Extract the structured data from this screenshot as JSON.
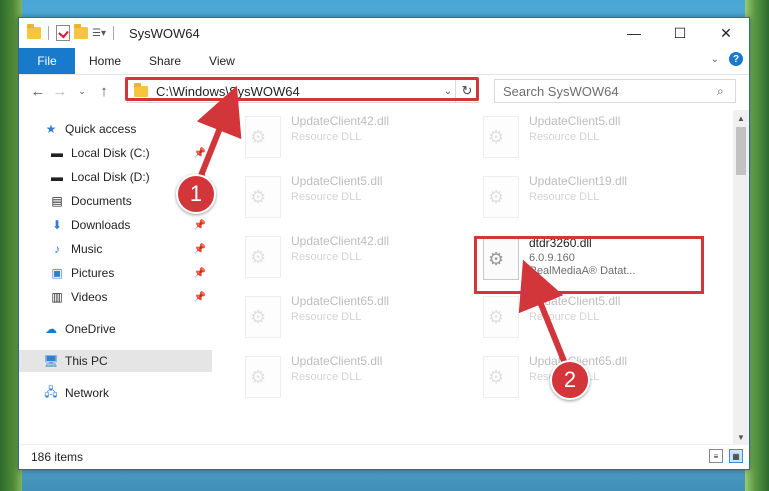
{
  "window": {
    "title": "SysWOW64"
  },
  "window_controls": {
    "minimize": "—",
    "maximize": "☐",
    "close": "✕"
  },
  "ribbon": {
    "tabs": [
      "File",
      "Home",
      "Share",
      "View"
    ],
    "help": "?"
  },
  "address": {
    "path": "C:\\Windows\\SysWOW64",
    "search_placeholder": "Search SysWOW64"
  },
  "sidebar": {
    "items": [
      {
        "label": "Quick access",
        "icon": "star-icon"
      },
      {
        "label": "Local Disk (C:)",
        "icon": "drive-icon"
      },
      {
        "label": "Local Disk (D:)",
        "icon": "drive-icon"
      },
      {
        "label": "Documents",
        "icon": "documents-icon"
      },
      {
        "label": "Downloads",
        "icon": "download-icon"
      },
      {
        "label": "Music",
        "icon": "music-icon"
      },
      {
        "label": "Pictures",
        "icon": "pictures-icon"
      },
      {
        "label": "Videos",
        "icon": "videos-icon"
      },
      {
        "label": "OneDrive",
        "icon": "cloud-icon"
      },
      {
        "label": "This PC",
        "icon": "computer-icon"
      },
      {
        "label": "Network",
        "icon": "network-icon"
      }
    ]
  },
  "files": [
    {
      "name": "UpdateClient42.dll",
      "sub": "Resource DLL"
    },
    {
      "name": "UpdateClient5.dll",
      "sub": "Resource DLL"
    },
    {
      "name": "UpdateClient5.dll",
      "sub": "Resource DLL"
    },
    {
      "name": "UpdateClient19.dll",
      "sub": "Resource DLL"
    },
    {
      "name": "UpdateClient42.dll",
      "sub": "Resource DLL"
    },
    {
      "name": "dtdr3260.dll",
      "sub": "6.0.9.160",
      "sub2": "RealMediaA® Datat..."
    },
    {
      "name": "UpdateClient65.dll",
      "sub": "Resource DLL"
    },
    {
      "name": "UpdateClient5.dll",
      "sub": "Resource DLL"
    },
    {
      "name": "UpdateClient5.dll",
      "sub": "Resource DLL"
    },
    {
      "name": "UpdateClient65.dll",
      "sub": "Resource DLL"
    }
  ],
  "status": {
    "count": "186 items"
  },
  "callouts": {
    "one": "1",
    "two": "2"
  },
  "colors": {
    "accent": "#1979ca",
    "highlight": "#d2353a"
  }
}
